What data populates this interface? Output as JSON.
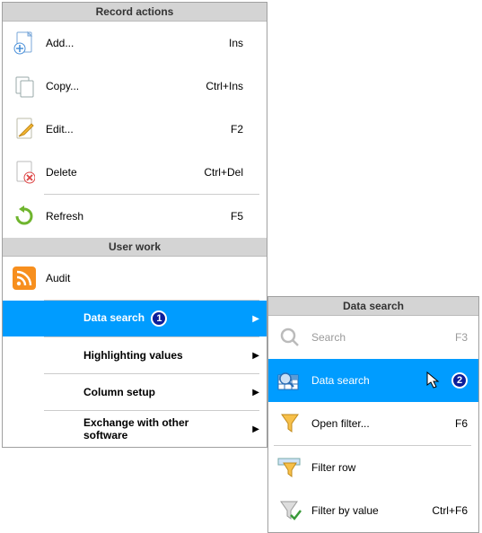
{
  "main": {
    "sections": {
      "record": "Record actions",
      "user": "User work"
    },
    "add": {
      "label": "Add...",
      "shortcut": "Ins"
    },
    "copy": {
      "label": "Copy...",
      "shortcut": "Ctrl+Ins"
    },
    "edit": {
      "label": "Edit...",
      "shortcut": "F2"
    },
    "delete": {
      "label": "Delete",
      "shortcut": "Ctrl+Del"
    },
    "refresh": {
      "label": "Refresh",
      "shortcut": "F5"
    },
    "audit": {
      "label": "Audit"
    },
    "datasearch": {
      "label": "Data search",
      "badge": "1"
    },
    "highlight": {
      "label": "Highlighting values"
    },
    "colsetup": {
      "label": "Column setup"
    },
    "exchange": {
      "label": "Exchange with other software"
    }
  },
  "sub": {
    "header": "Data search",
    "search": {
      "label": "Search",
      "shortcut": "F3"
    },
    "datasearch": {
      "label": "Data search",
      "badge": "2"
    },
    "openfilter": {
      "label": "Open filter...",
      "shortcut": "F6"
    },
    "filterrow": {
      "label": "Filter row"
    },
    "filterval": {
      "label": "Filter by value",
      "shortcut": "Ctrl+F6"
    }
  }
}
